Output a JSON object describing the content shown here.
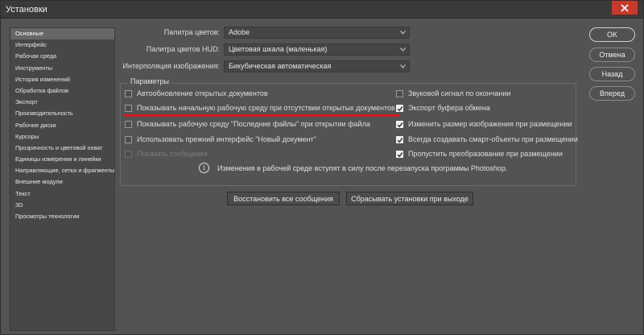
{
  "window": {
    "title": "Установки"
  },
  "sidebar": {
    "items": [
      {
        "label": "Основные"
      },
      {
        "label": "Интерфейс"
      },
      {
        "label": "Рабочая среда"
      },
      {
        "label": "Инструменты"
      },
      {
        "label": "История изменений"
      },
      {
        "label": "Обработка файлов"
      },
      {
        "label": "Экспорт"
      },
      {
        "label": "Производительность"
      },
      {
        "label": "Рабочие диски"
      },
      {
        "label": "Курсоры"
      },
      {
        "label": "Прозрачность и цветовой охват"
      },
      {
        "label": "Единицы измерения и линейки"
      },
      {
        "label": "Направляющие, сетка и фрагменты"
      },
      {
        "label": "Внешние модули"
      },
      {
        "label": "Текст"
      },
      {
        "label": "3D"
      },
      {
        "label": "Просмотры технологии"
      }
    ]
  },
  "settings": {
    "color_picker_label": "Палитра цветов:",
    "color_picker_value": "Adobe",
    "hud_picker_label": "Палитра цветов HUD:",
    "hud_picker_value": "Цветовая шкала (маленькая)",
    "interpolation_label": "Интерполяция изображения:",
    "interpolation_value": "Бикубическая автоматическая"
  },
  "options": {
    "title": "Параметры",
    "left": [
      {
        "label": "Автообновление открытых документов",
        "checked": false,
        "disabled": false
      },
      {
        "label": "Показывать начальную рабочую среду при отсутствии открытых документов",
        "checked": false,
        "disabled": false
      },
      {
        "label": "Показывать рабочую среду \"Последние файлы\" при открытии файла",
        "checked": false,
        "disabled": false
      },
      {
        "label": "Использовать прежний интерфейс \"Новый документ\"",
        "checked": false,
        "disabled": false
      },
      {
        "label": "Показать сообщения",
        "checked": false,
        "disabled": true
      }
    ],
    "right": [
      {
        "label": "Звуковой сигнал по окончании",
        "checked": false
      },
      {
        "label": "Экспорт буфера обмена",
        "checked": true
      },
      {
        "label": "Изменить размер изображения при размещении",
        "checked": true
      },
      {
        "label": "Всегда создавать смарт-объекты при размещении",
        "checked": true
      },
      {
        "label": "Пропустить преобразование при размещении",
        "checked": true
      }
    ],
    "info_icon": "i",
    "info": "Изменения в рабочей среде вступят в силу после перезапуска программы Photoshop."
  },
  "actions": {
    "restore_messages": "Восстановить все сообщения",
    "reset_on_exit": "Сбрасывать установки при выходе"
  },
  "buttons": {
    "ok": "OK",
    "cancel": "Отмена",
    "back": "Назад",
    "next": "Вперед"
  },
  "colors": {
    "highlight_line": "#d31a22",
    "close": "#c43b2e"
  }
}
